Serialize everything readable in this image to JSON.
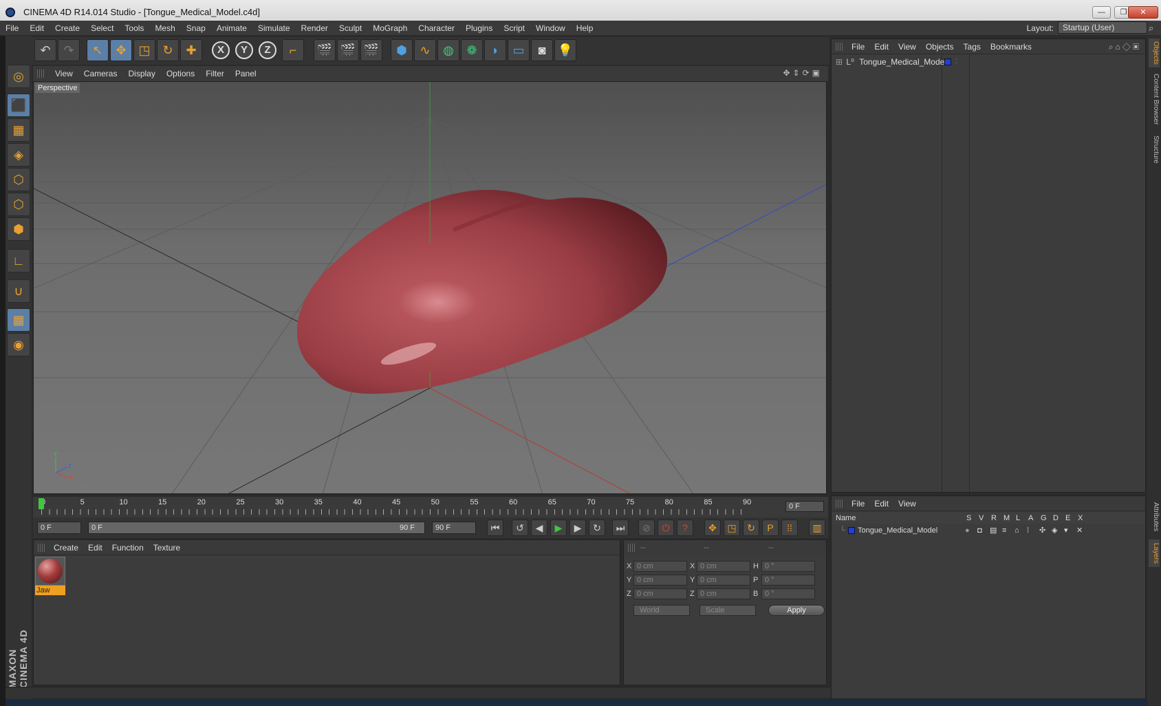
{
  "window": {
    "title": "CINEMA 4D R14.014 Studio - [Tongue_Medical_Model.c4d]",
    "minimize": "—",
    "restore": "❐",
    "close": "✕"
  },
  "menubar": {
    "items": [
      "File",
      "Edit",
      "Create",
      "Select",
      "Tools",
      "Mesh",
      "Snap",
      "Animate",
      "Simulate",
      "Render",
      "Sculpt",
      "MoGraph",
      "Character",
      "Plugins",
      "Script",
      "Window",
      "Help"
    ],
    "layout_label": "Layout:",
    "layout_value": "Startup (User)"
  },
  "viewport": {
    "menu": [
      "View",
      "Cameras",
      "Display",
      "Options",
      "Filter",
      "Panel"
    ],
    "label": "Perspective",
    "axis_y": "Y",
    "axis_x": "X",
    "axis_z": "Z"
  },
  "timeline": {
    "ticks": [
      "0",
      "5",
      "10",
      "15",
      "20",
      "25",
      "30",
      "35",
      "40",
      "45",
      "50",
      "55",
      "60",
      "65",
      "70",
      "75",
      "80",
      "85",
      "90"
    ],
    "current": "0 F",
    "start_field": "0 F",
    "range_start": "0 F",
    "range_end": "90 F",
    "end_field": "90 F"
  },
  "materials": {
    "menu": [
      "Create",
      "Edit",
      "Function",
      "Texture"
    ],
    "items": [
      {
        "name": "Jaw"
      }
    ]
  },
  "coordinates": {
    "headers": [
      "--",
      "--",
      "--"
    ],
    "rows": [
      {
        "a": "X",
        "v1": "0 cm",
        "b": "X",
        "v2": "0 cm",
        "c": "H",
        "v3": "0 °"
      },
      {
        "a": "Y",
        "v1": "0 cm",
        "b": "Y",
        "v2": "0 cm",
        "c": "P",
        "v3": "0 °"
      },
      {
        "a": "Z",
        "v1": "0 cm",
        "b": "Z",
        "v2": "0 cm",
        "c": "B",
        "v3": "0 °"
      }
    ],
    "world": "World",
    "scale": "Scale",
    "apply": "Apply"
  },
  "objects": {
    "menu": [
      "File",
      "Edit",
      "View",
      "Objects",
      "Tags",
      "Bookmarks"
    ],
    "items": [
      {
        "name": "Tongue_Medical_Model",
        "layer_color": "#2040d0"
      }
    ]
  },
  "layers": {
    "menu": [
      "File",
      "Edit",
      "View"
    ],
    "columns": [
      "Name",
      "S",
      "V",
      "R",
      "M",
      "L",
      "A",
      "G",
      "D",
      "E",
      "X"
    ],
    "items": [
      {
        "name": "Tongue_Medical_Model",
        "color": "#2040d0"
      }
    ]
  },
  "side_tabs": [
    "Objects",
    "Content Browser",
    "Structure",
    "Attributes",
    "Layers"
  ],
  "branding": "MAXON CINEMA 4D",
  "colors": {
    "accent": "#e8a030",
    "tongue": "#a8464c",
    "selection": "#5b7fa6"
  }
}
